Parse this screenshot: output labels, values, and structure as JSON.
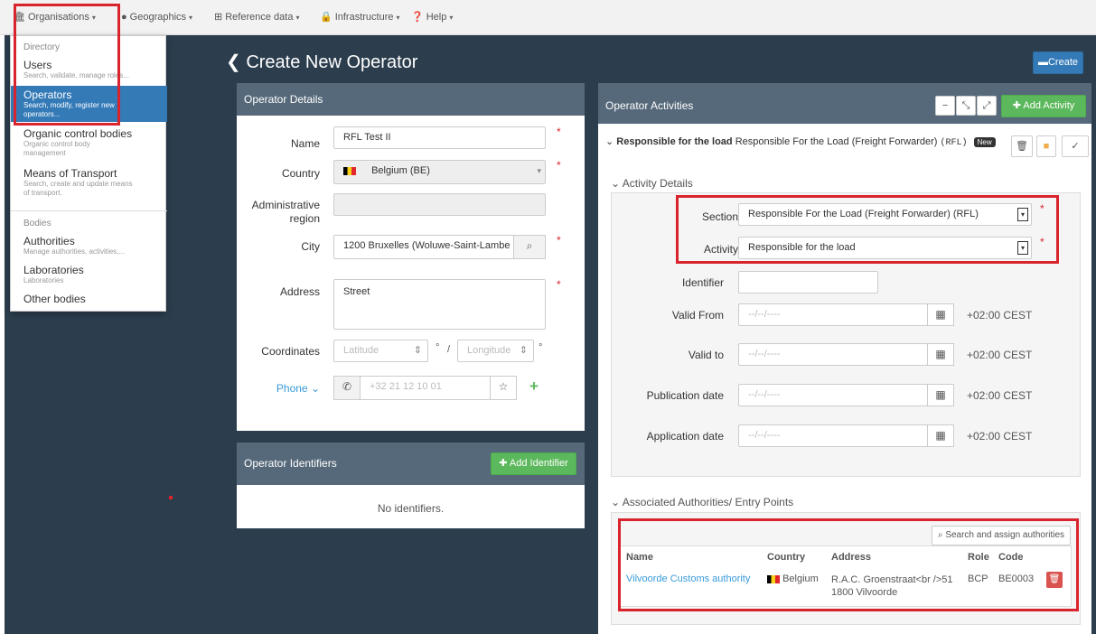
{
  "nav": {
    "organisations": "Organisations",
    "geographics": "Geographics",
    "reference_data": "Reference data",
    "infrastructure": "Infrastructure",
    "help": "Help"
  },
  "dropdown": {
    "directory_header": "Directory",
    "items": [
      {
        "title": "Users",
        "subtitle": "Search, validate, manage roles..."
      },
      {
        "title": "Operators",
        "subtitle1": "Search, modify, register new",
        "subtitle2": "operators..."
      },
      {
        "title": "Organic control bodies",
        "subtitle1": "Organic control body",
        "subtitle2": "management"
      },
      {
        "title": "Means of Transport",
        "subtitle1": "Search, create and update means",
        "subtitle2": "of transport."
      }
    ],
    "bodies_header": "Bodies",
    "bodies": [
      {
        "title": "Authorities",
        "subtitle": "Manage authorities, activities,..."
      },
      {
        "title": "Laboratories",
        "subtitle": "Laboratories"
      },
      {
        "title": "Other bodies"
      }
    ]
  },
  "page": {
    "title": "Create New Operator",
    "create_label": "Create"
  },
  "operator_details": {
    "heading": "Operator Details",
    "name_label": "Name",
    "name_value": "RFL Test II",
    "country_label": "Country",
    "country_value": "Belgium (BE)",
    "admin_label1": "Administrative",
    "admin_label2": "region",
    "city_label": "City",
    "city_value": "1200 Bruxelles (Woluwe-Saint-Lambe",
    "address_label": "Address",
    "address_value": "Street",
    "coordinates_label": "Coordinates",
    "latitude_ph": "Latitude",
    "longitude_ph": "Longitude",
    "deg": "°",
    "slash": "/",
    "phone_label": "Phone",
    "phone_ph": "+32 21 12 10 01"
  },
  "operator_identifiers": {
    "heading": "Operator Identifiers",
    "add_label": "Add Identifier",
    "empty": "No identifiers."
  },
  "activities": {
    "heading": "Operator Activities",
    "add_label": "Add Activity",
    "activity_bold": "Responsible for the load",
    "activity_rest": "Responsible For the Load (Freight Forwarder)",
    "activity_code": "(RFL)",
    "badge": "New",
    "details_title": "Activity Details",
    "section_label": "Section",
    "section_value": "Responsible For the Load (Freight Forwarder) (RFL)",
    "activity_label": "Activity",
    "activity_value": "Responsible for the load",
    "identifier_label": "Identifier",
    "valid_from_label": "Valid From",
    "valid_to_label": "Valid to",
    "publication_label": "Publication date",
    "application_label": "Application date",
    "date_ph": "--/--/----",
    "tz": "+02:00 CEST"
  },
  "authorities": {
    "title": "Associated Authorities/ Entry Points",
    "search_label": "Search and assign authorities",
    "headers": {
      "name": "Name",
      "country": "Country",
      "address": "Address",
      "role": "Role",
      "code": "Code"
    },
    "rows": [
      {
        "name": "Vilvoorde Customs authority",
        "country": "Belgium",
        "address1": "R.A.C. Groenstraat<br />51",
        "address2": "1800 Vilvoorde",
        "role": "BCP",
        "code": "BE0003"
      }
    ]
  }
}
